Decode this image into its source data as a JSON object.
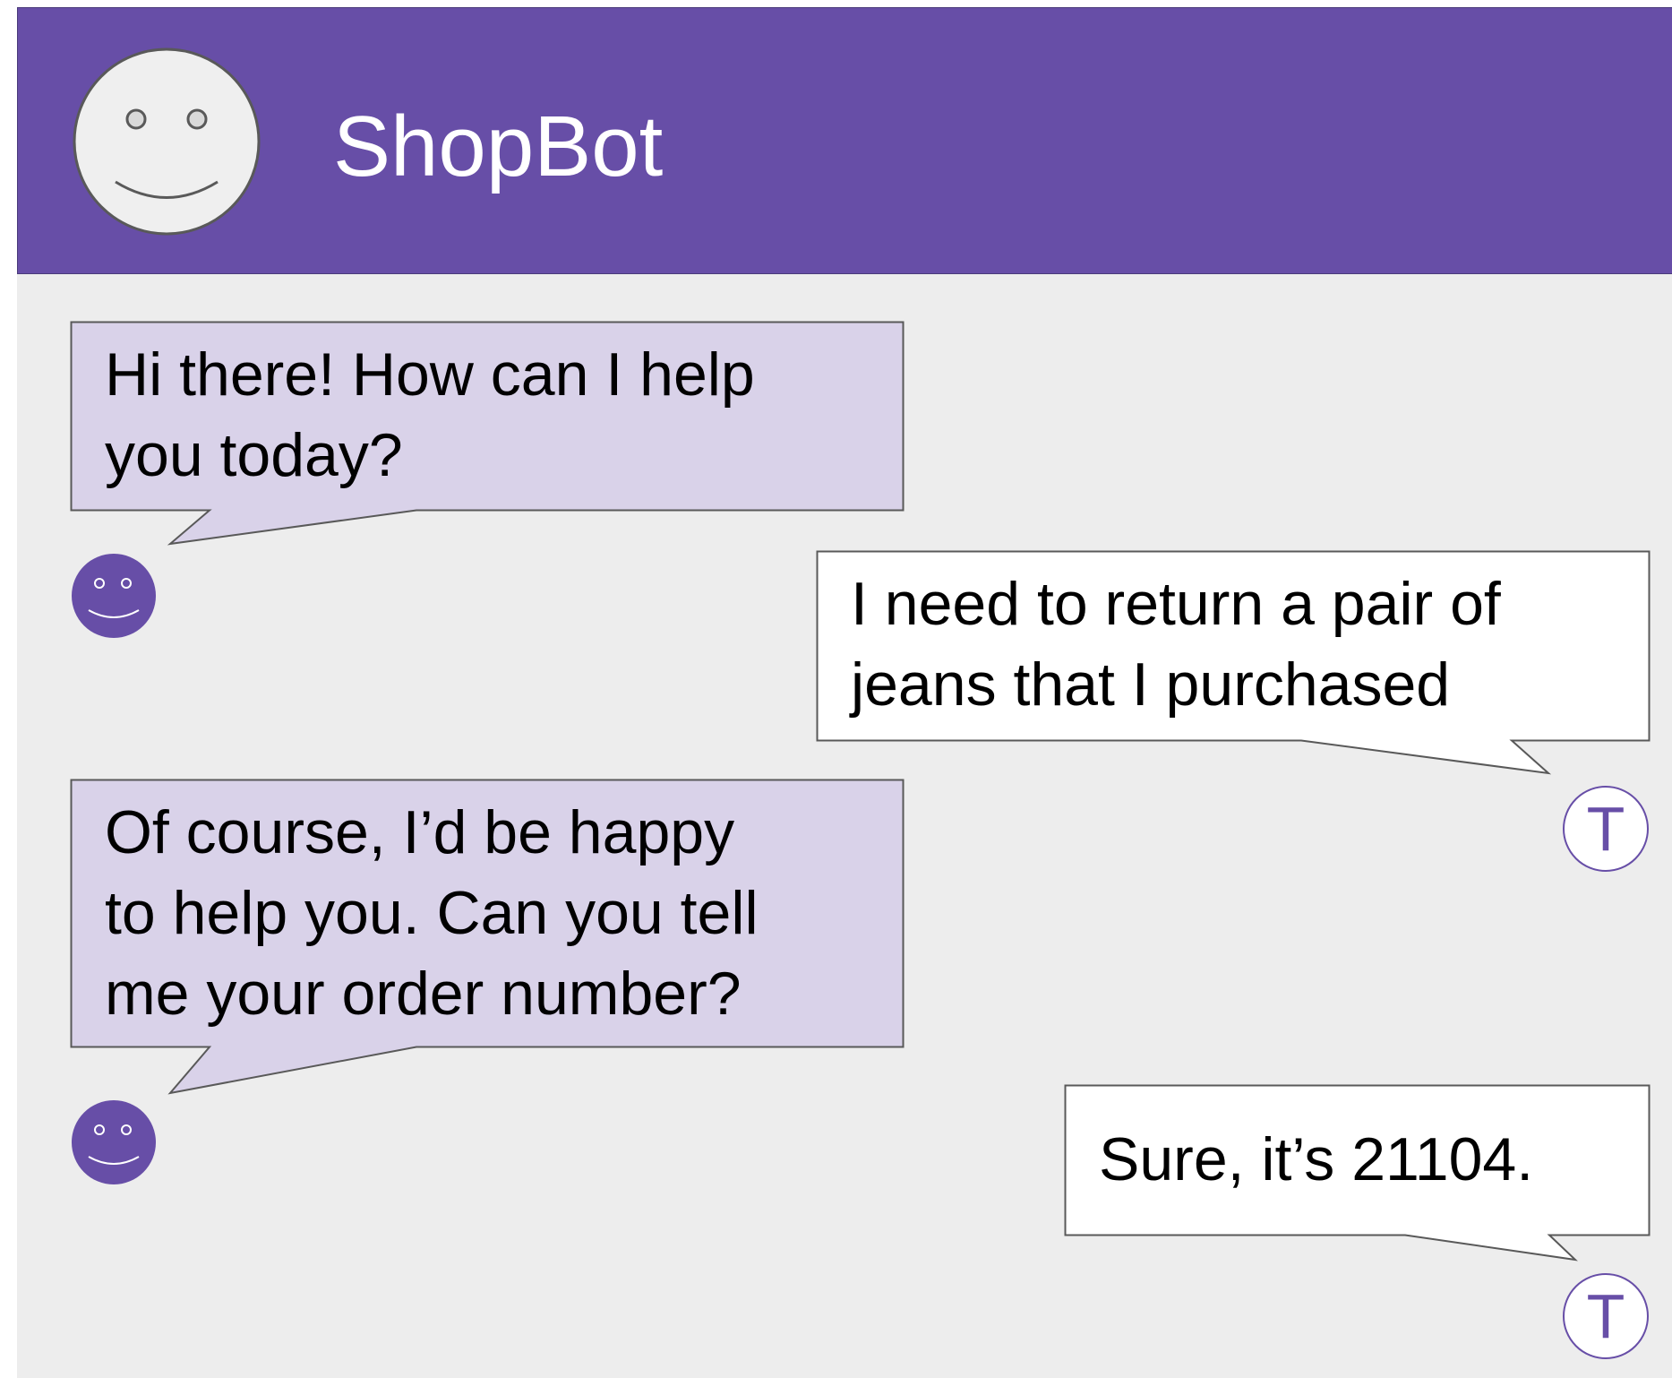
{
  "header": {
    "title": "ShopBot",
    "background_color": "#674ea7",
    "avatar_icon": "smiley-face-icon"
  },
  "colors": {
    "chat_background": "#ededed",
    "bot_bubble": "#d9d2e9",
    "user_bubble": "#ffffff",
    "accent": "#674ea7"
  },
  "messages": [
    {
      "sender": "bot",
      "lines": [
        "Hi there! How can I help",
        "you today?"
      ],
      "avatar_icon": "bot-smiley-icon"
    },
    {
      "sender": "user",
      "lines": [
        "I need to return a pair of",
        "jeans that I purchased"
      ],
      "avatar_label": "T"
    },
    {
      "sender": "bot",
      "lines": [
        "Of course, I’d be happy",
        "to help you. Can you tell",
        "me your order number?"
      ],
      "avatar_icon": "bot-smiley-icon"
    },
    {
      "sender": "user",
      "lines": [
        "Sure, it’s 21104."
      ],
      "avatar_label": "T"
    }
  ]
}
